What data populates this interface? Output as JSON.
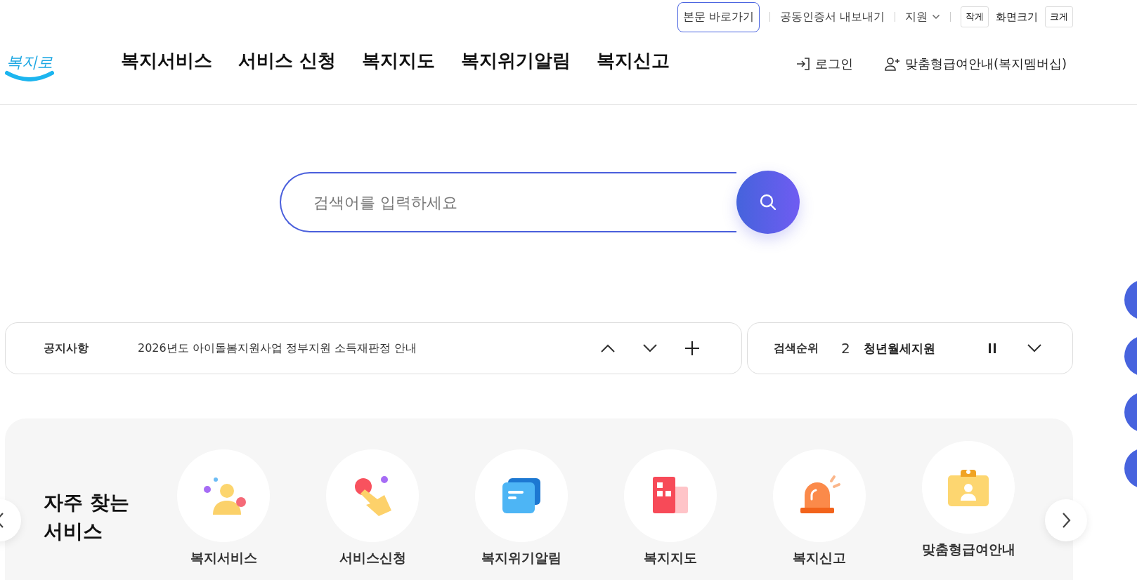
{
  "utility_links": [
    {
      "label": "본문 바로가기",
      "kind": "focused"
    },
    {
      "label": "공동인증서 내보내기",
      "kind": "link"
    },
    {
      "label": "지원",
      "kind": "dropdown"
    }
  ],
  "font_size": {
    "smaller": "작게",
    "label": "화면크기",
    "larger": "크게"
  },
  "logo": "복지로",
  "nav": [
    "복지서비스",
    "서비스 신청",
    "복지지도",
    "복지위기알림",
    "복지신고"
  ],
  "account": [
    {
      "label": "로그인",
      "kind": "login"
    },
    {
      "label": "맞춤형급여안내(복지멤버십)",
      "kind": "member"
    }
  ],
  "search": {
    "placeholder": "검색어를 입력하세요"
  },
  "notice": {
    "label": "공지사항",
    "text": "2026년도 아이돌봄지원사업 정부지원 소득재판정 안내"
  },
  "ranking": {
    "label": "검색순위",
    "rank": "2",
    "term": "청년월세지원"
  },
  "services": {
    "title": "자주 찾는 서비스",
    "items": [
      "복지서비스",
      "서비스신청",
      "복지위기알림",
      "복지지도",
      "복지신고",
      "맞춤형급여안내"
    ]
  }
}
